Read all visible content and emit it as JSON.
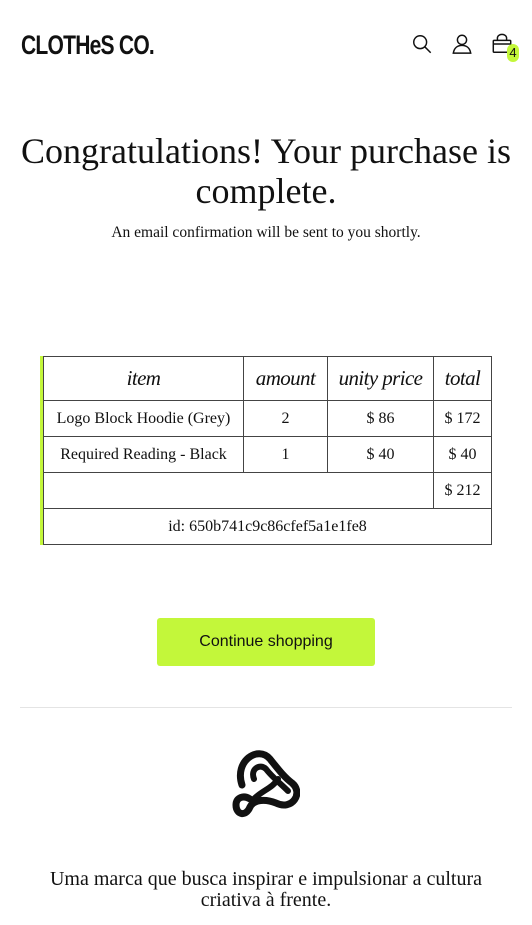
{
  "header": {
    "brand": "CLOTHeS CO.",
    "icons": [
      "search-icon",
      "user-icon",
      "cart-icon"
    ],
    "cart_count": "4"
  },
  "hero": {
    "title": "Congratulations! Your purchase is complete.",
    "subtitle": "An email confirmation will be sent to you shortly."
  },
  "order": {
    "columns": [
      "item",
      "amount",
      "unity price",
      "total"
    ],
    "rows": [
      {
        "item": "Logo Block Hoodie (Grey)",
        "amount": "2",
        "unit_price": "$ 86",
        "total": "$ 172"
      },
      {
        "item": "Required Reading - Black",
        "amount": "1",
        "unit_price": "$ 40",
        "total": "$ 40"
      }
    ],
    "grand_total": "$ 212",
    "id_text": "id: 650b741c9c86cfef5a1e1fe8"
  },
  "actions": {
    "continue_label": "Continue shopping"
  },
  "footer": {
    "logo_icon": "brand-knot-icon",
    "tagline": "Uma marca que busca inspirar e impulsionar a cultura criativa à frente."
  },
  "colors": {
    "accent": "#c3f73a",
    "text": "#111111",
    "border": "#444444"
  }
}
